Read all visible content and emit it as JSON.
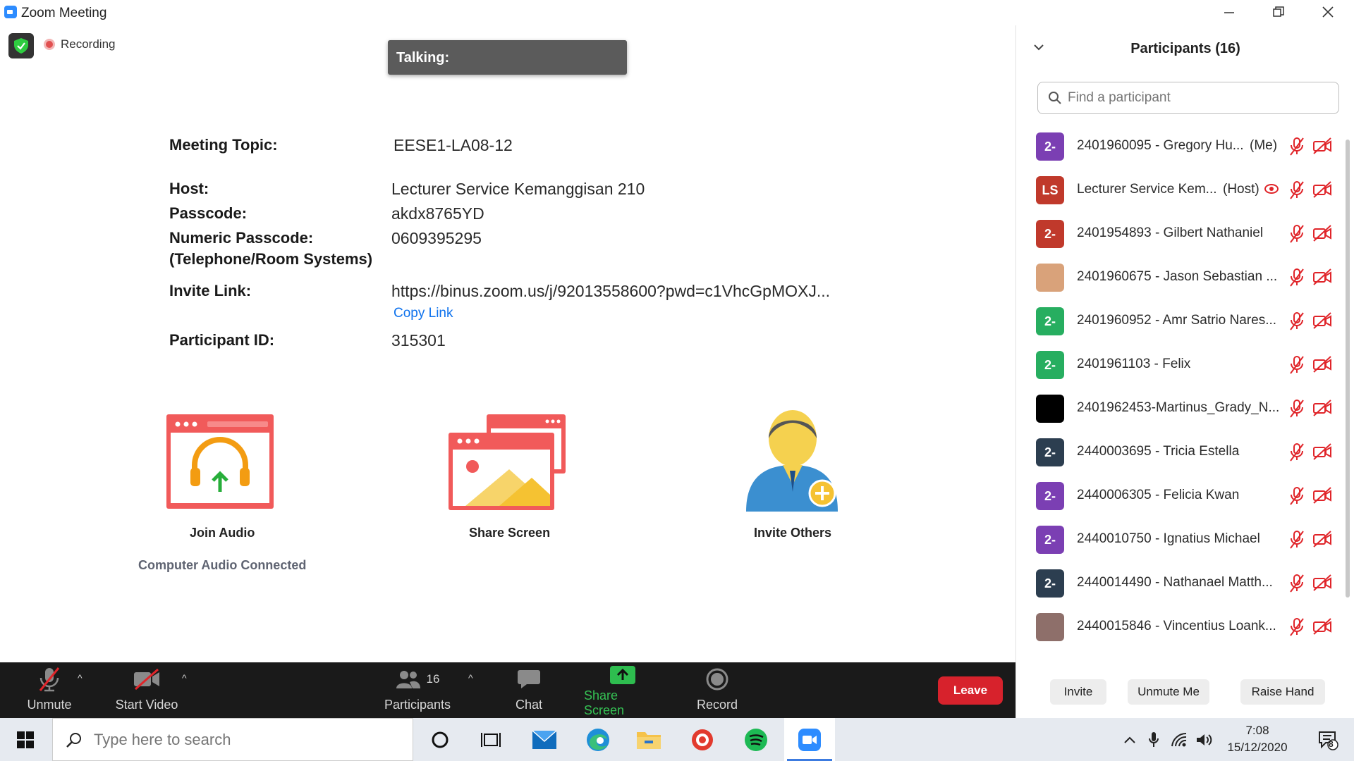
{
  "window": {
    "title": "Zoom Meeting",
    "minimize": "—",
    "restore": "❐",
    "close": "✕"
  },
  "status": {
    "recording": "Recording",
    "talking": "Talking:"
  },
  "meeting": {
    "topic_label": "Meeting Topic:",
    "topic": "EESE1-LA08-12",
    "host_label": "Host:",
    "host": "Lecturer Service Kemanggisan 210",
    "passcode_label": "Passcode:",
    "passcode": "akdx8765YD",
    "numeric_label": "Numeric Passcode:",
    "numeric_sub": "(Telephone/Room Systems)",
    "numeric": "0609395295",
    "invite_label": "Invite Link:",
    "invite": "https://binus.zoom.us/j/92013558600?pwd=c1VhcGpMOXJ...",
    "copy_link": "Copy Link",
    "pid_label": "Participant ID:",
    "pid": "315301"
  },
  "actions": {
    "join_audio": "Join Audio",
    "share_screen": "Share Screen",
    "invite_others": "Invite Others",
    "audio_status": "Computer Audio Connected"
  },
  "toolbar": {
    "unmute": "Unmute",
    "start_video": "Start Video",
    "participants": "Participants",
    "participants_count": "16",
    "chat": "Chat",
    "share_screen": "Share Screen",
    "record": "Record",
    "leave": "Leave",
    "caret": "^"
  },
  "panel": {
    "title": "Participants (16)",
    "search_placeholder": "Find a participant",
    "participants": [
      {
        "initials": "2-",
        "name": "2401960095 - Gregory Hu...",
        "tag": "(Me)",
        "color": "#7b3fb3"
      },
      {
        "initials": "LS",
        "name": "Lecturer Service Kem...",
        "tag": "(Host)",
        "color": "#c0392b"
      },
      {
        "initials": "2-",
        "name": "2401954893 - Gilbert Nathaniel",
        "tag": "",
        "color": "#c0392b"
      },
      {
        "initials": "",
        "name": "2401960675 - Jason Sebastian ...",
        "tag": "",
        "color": "#d9a27a"
      },
      {
        "initials": "2-",
        "name": "2401960952 - Amr Satrio Nares...",
        "tag": "",
        "color": "#27ae60"
      },
      {
        "initials": "2-",
        "name": "2401961103 - Felix",
        "tag": "",
        "color": "#27ae60"
      },
      {
        "initials": "",
        "name": "2401962453-Martinus_Grady_N...",
        "tag": "",
        "color": "#000000"
      },
      {
        "initials": "2-",
        "name": "2440003695 - Tricia Estella",
        "tag": "",
        "color": "#2c3e50"
      },
      {
        "initials": "2-",
        "name": "2440006305 - Felicia Kwan",
        "tag": "",
        "color": "#7b3fb3"
      },
      {
        "initials": "2-",
        "name": "2440010750 - Ignatius Michael",
        "tag": "",
        "color": "#7b3fb3"
      },
      {
        "initials": "2-",
        "name": "2440014490 - Nathanael Matth...",
        "tag": "",
        "color": "#2c3e50"
      },
      {
        "initials": "",
        "name": "2440015846 - Vincentius Loank...",
        "tag": "",
        "color": "#8e6f6a"
      }
    ],
    "invite": "Invite",
    "unmute_me": "Unmute Me",
    "raise_hand": "Raise Hand"
  },
  "taskbar": {
    "search_placeholder": "Type here to search",
    "time": "7:08",
    "date": "15/12/2020",
    "notifications": "8"
  }
}
